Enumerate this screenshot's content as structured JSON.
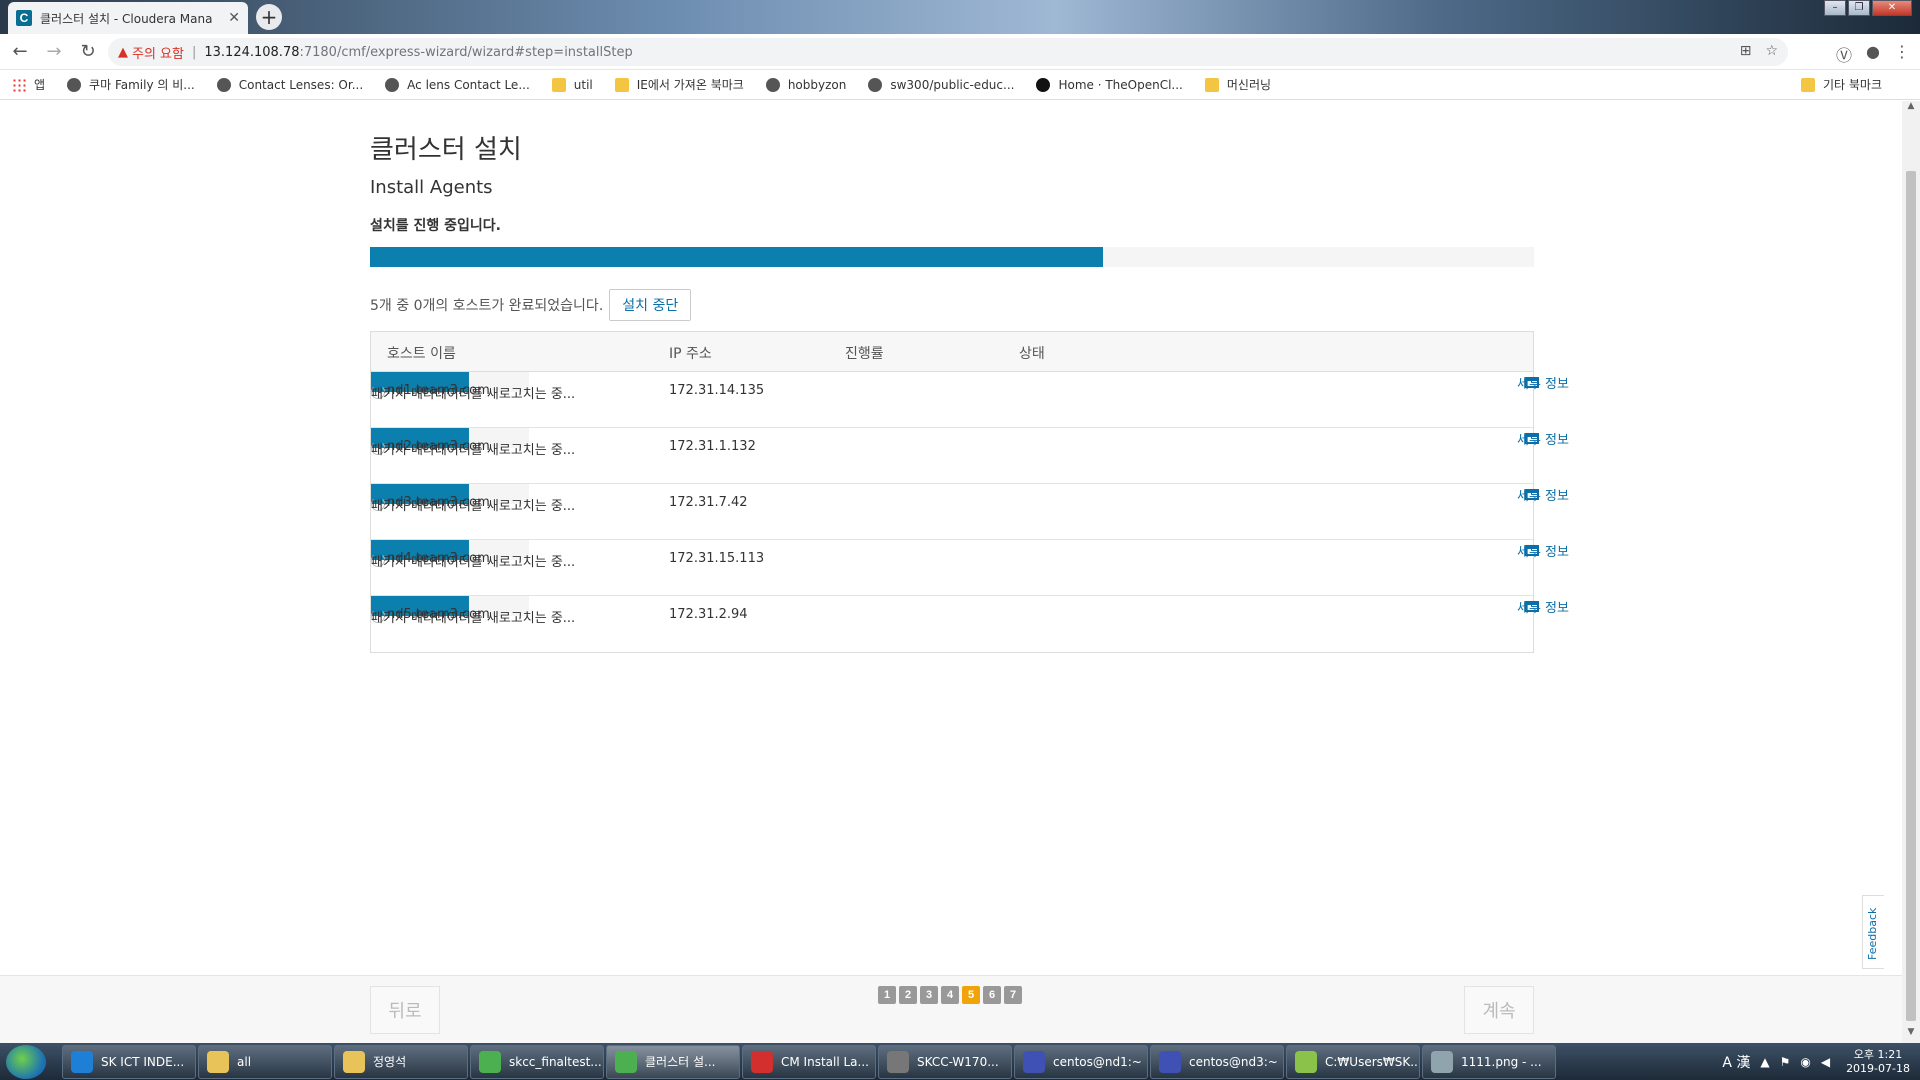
{
  "browser": {
    "tab_title": "클러스터 설치 - Cloudera Mana",
    "favicon_letter": "C",
    "security_label": "주의 요함",
    "url_host": "13.124.108.78",
    "url_rest": ":7180/cmf/express-wizard/wizard#step=installStep"
  },
  "bookmarks": {
    "items": [
      {
        "label": "앱",
        "icon": "apps-icon"
      },
      {
        "label": "쿠마 Family 의 비...",
        "icon": "globe-icon"
      },
      {
        "label": "Contact Lenses: Or...",
        "icon": "globe-icon"
      },
      {
        "label": "Ac lens Contact Le...",
        "icon": "globe-icon"
      },
      {
        "label": "util",
        "icon": "folder-icon"
      },
      {
        "label": "IE에서 가져온 북마크",
        "icon": "folder-icon"
      },
      {
        "label": "hobbyzon",
        "icon": "globe-icon"
      },
      {
        "label": "sw300/public-educ...",
        "icon": "globe-icon"
      },
      {
        "label": "Home · TheOpenCl...",
        "icon": "github-icon"
      },
      {
        "label": "머신러닝",
        "icon": "folder-icon"
      }
    ],
    "other": "기타 북마크"
  },
  "page": {
    "title": "클러스터 설치",
    "subtitle": "Install Agents",
    "status_message": "설치를 진행 중입니다.",
    "overall_progress": 0.63,
    "completed_text": "5개 중 0개의 호스트가 완료되었습니다.",
    "stop_button": "설치 중단",
    "table": {
      "headers": {
        "host": "호스트 이름",
        "ip": "IP 주소",
        "progress": "진행률",
        "status": "상태"
      },
      "rows": [
        {
          "host": "nd1.team3.com",
          "ip": "172.31.14.135",
          "progress": 0.62,
          "status": "패키지 메타데이터를 새로고치는 중...",
          "details": "세부 정보"
        },
        {
          "host": "nd2.team3.com",
          "ip": "172.31.1.132",
          "progress": 0.62,
          "status": "패키지 메타데이터를 새로고치는 중...",
          "details": "세부 정보"
        },
        {
          "host": "nd3.team3.com",
          "ip": "172.31.7.42",
          "progress": 0.62,
          "status": "패키지 메타데이터를 새로고치는 중...",
          "details": "세부 정보"
        },
        {
          "host": "nd4.team3.com",
          "ip": "172.31.15.113",
          "progress": 0.62,
          "status": "패키지 메타데이터를 새로고치는 중...",
          "details": "세부 정보"
        },
        {
          "host": "nd5.team3.com",
          "ip": "172.31.2.94",
          "progress": 0.62,
          "status": "패키지 메타데이터를 새로고치는 중...",
          "details": "세부 정보"
        }
      ]
    },
    "feedback": "Feedback",
    "footer": {
      "back": "뒤로",
      "next": "계속",
      "steps": [
        "1",
        "2",
        "3",
        "4",
        "5",
        "6",
        "7"
      ],
      "current_step": "5"
    }
  },
  "taskbar": {
    "tasks": [
      {
        "label": "SK ICT INDE...",
        "color": "#1e7fd6"
      },
      {
        "label": "all",
        "color": "#e8c35a"
      },
      {
        "label": "정영석",
        "color": "#e8c35a"
      },
      {
        "label": "skcc_finaltest...",
        "color": "#4caf50"
      },
      {
        "label": "클러스터 설...",
        "color": "#4caf50",
        "active": true
      },
      {
        "label": "CM Install La...",
        "color": "#d32f2f"
      },
      {
        "label": "SKCC-W170...",
        "color": "#777777"
      },
      {
        "label": "centos@nd1:~",
        "color": "#3f51b5"
      },
      {
        "label": "centos@nd3:~",
        "color": "#3f51b5"
      },
      {
        "label": "C:₩Users₩SK...",
        "color": "#8bc34a"
      },
      {
        "label": "1111.png - ...",
        "color": "#90a4ae"
      }
    ],
    "ime": "A 漢",
    "time": "오후 1:21",
    "date": "2019-07-18"
  }
}
